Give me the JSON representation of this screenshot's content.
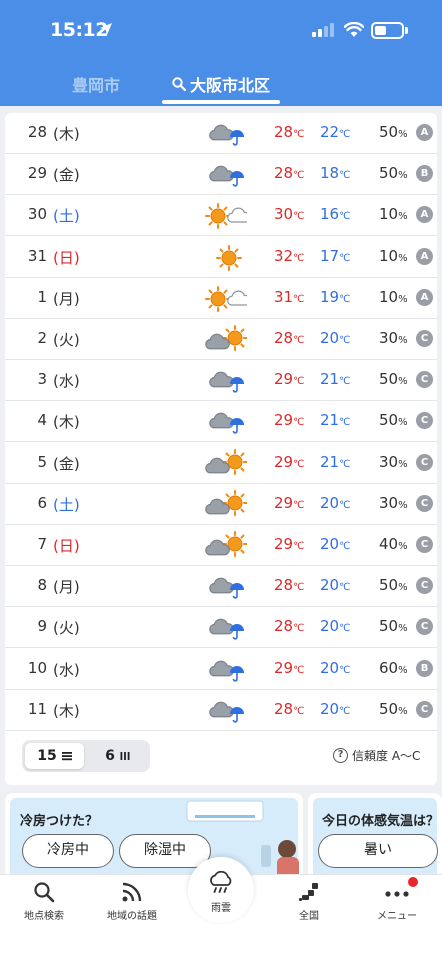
{
  "status_bar": {
    "time": "15:12"
  },
  "location_tabs": [
    {
      "label": "豊岡市",
      "active": false
    },
    {
      "label": "大阪市北区",
      "active": true
    }
  ],
  "forecast": [
    {
      "day": "28",
      "dow": "(木)",
      "dow_type": "weekday",
      "weather": "cloudy-umbrella",
      "high": "28",
      "low": "22",
      "prob": "50",
      "reliability": "A"
    },
    {
      "day": "29",
      "dow": "(金)",
      "dow_type": "weekday",
      "weather": "cloudy-umbrella",
      "high": "28",
      "low": "18",
      "prob": "50",
      "reliability": "B"
    },
    {
      "day": "30",
      "dow": "(土)",
      "dow_type": "saturday",
      "weather": "sunny-cloudy",
      "high": "30",
      "low": "16",
      "prob": "10",
      "reliability": "A"
    },
    {
      "day": "31",
      "dow": "(日)",
      "dow_type": "sunday",
      "weather": "sunny",
      "high": "32",
      "low": "17",
      "prob": "10",
      "reliability": "A"
    },
    {
      "day": "1",
      "dow": "(月)",
      "dow_type": "weekday",
      "weather": "sunny-cloudy",
      "high": "31",
      "low": "19",
      "prob": "10",
      "reliability": "A"
    },
    {
      "day": "2",
      "dow": "(火)",
      "dow_type": "weekday",
      "weather": "cloudy-sunny",
      "high": "28",
      "low": "20",
      "prob": "30",
      "reliability": "C"
    },
    {
      "day": "3",
      "dow": "(水)",
      "dow_type": "weekday",
      "weather": "cloudy-umbrella",
      "high": "29",
      "low": "21",
      "prob": "50",
      "reliability": "C"
    },
    {
      "day": "4",
      "dow": "(木)",
      "dow_type": "weekday",
      "weather": "cloudy-umbrella",
      "high": "29",
      "low": "21",
      "prob": "50",
      "reliability": "C"
    },
    {
      "day": "5",
      "dow": "(金)",
      "dow_type": "weekday",
      "weather": "cloudy-sunny",
      "high": "29",
      "low": "21",
      "prob": "30",
      "reliability": "C"
    },
    {
      "day": "6",
      "dow": "(土)",
      "dow_type": "saturday",
      "weather": "cloudy-sunny",
      "high": "29",
      "low": "20",
      "prob": "30",
      "reliability": "C"
    },
    {
      "day": "7",
      "dow": "(日)",
      "dow_type": "sunday",
      "weather": "cloudy-sunny",
      "high": "29",
      "low": "20",
      "prob": "40",
      "reliability": "C"
    },
    {
      "day": "8",
      "dow": "(月)",
      "dow_type": "weekday",
      "weather": "cloudy-umbrella",
      "high": "28",
      "low": "20",
      "prob": "50",
      "reliability": "C"
    },
    {
      "day": "9",
      "dow": "(火)",
      "dow_type": "weekday",
      "weather": "cloudy-umbrella",
      "high": "28",
      "low": "20",
      "prob": "50",
      "reliability": "C"
    },
    {
      "day": "10",
      "dow": "(水)",
      "dow_type": "weekday",
      "weather": "cloudy-umbrella",
      "high": "29",
      "low": "20",
      "prob": "60",
      "reliability": "B"
    },
    {
      "day": "11",
      "dow": "(木)",
      "dow_type": "weekday",
      "weather": "cloudy-umbrella",
      "high": "28",
      "low": "20",
      "prob": "50",
      "reliability": "C"
    }
  ],
  "units": {
    "temp": "℃",
    "percent": "%"
  },
  "view_toggle": {
    "option_15": "15",
    "option_6": "6",
    "selected": "15"
  },
  "reliability_note": "信頼度 A～C",
  "promos": {
    "card1": {
      "title": "冷房つけた？",
      "buttons": [
        "冷房中",
        "除湿中"
      ]
    },
    "card2": {
      "title": "今日の体感気温は？",
      "buttons": [
        "暑い"
      ]
    }
  },
  "bottom_nav": {
    "search": "地点検索",
    "topics": "地域の話題",
    "radar": "雨雲",
    "national": "全国",
    "menu": "メニュー"
  },
  "colors": {
    "header": "#4a8ee8",
    "high_temp": "#d92a2a",
    "low_temp": "#2f6fe0",
    "saturday": "#2f6fe0",
    "sunday": "#d92a2a",
    "reliability_badge": "#9a9ea6",
    "notification": "#e8262b"
  }
}
